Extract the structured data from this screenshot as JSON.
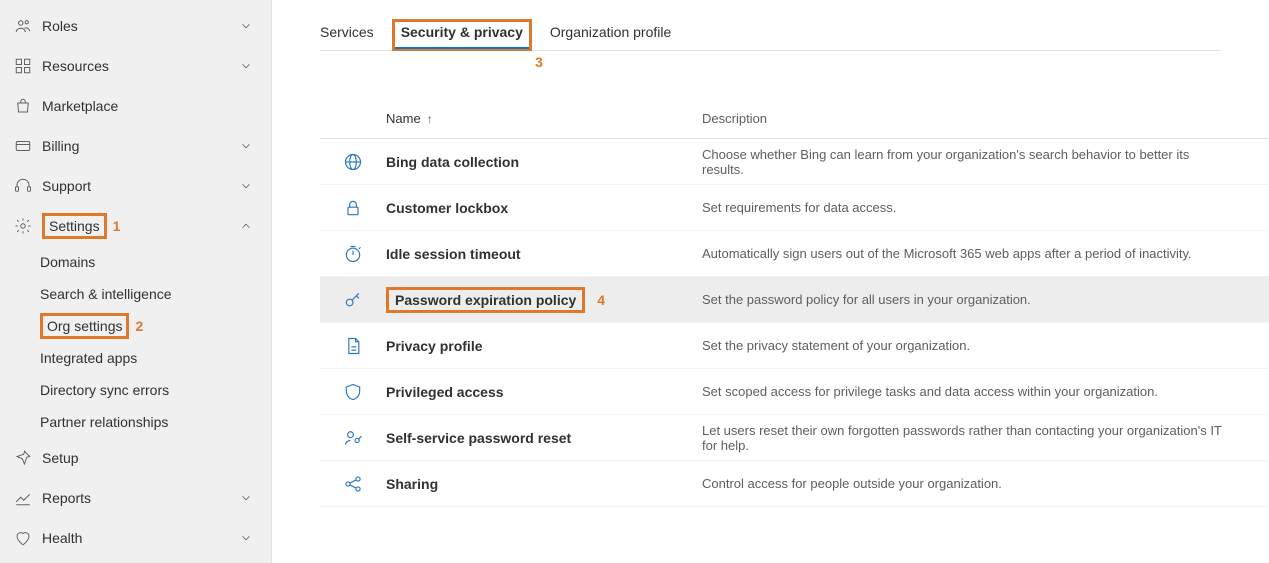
{
  "sidebar": {
    "items": [
      {
        "label": "Roles",
        "icon": "roles-icon",
        "expandable": true,
        "expanded": false
      },
      {
        "label": "Resources",
        "icon": "resources-icon",
        "expandable": true,
        "expanded": false
      },
      {
        "label": "Marketplace",
        "icon": "marketplace-icon",
        "expandable": false
      },
      {
        "label": "Billing",
        "icon": "billing-icon",
        "expandable": true,
        "expanded": false
      },
      {
        "label": "Support",
        "icon": "support-icon",
        "expandable": true,
        "expanded": false
      },
      {
        "label": "Settings",
        "icon": "settings-icon",
        "expandable": true,
        "expanded": true,
        "highlight_num": "1"
      },
      {
        "label": "Setup",
        "icon": "setup-icon",
        "expandable": false
      },
      {
        "label": "Reports",
        "icon": "reports-icon",
        "expandable": true,
        "expanded": false
      },
      {
        "label": "Health",
        "icon": "health-icon",
        "expandable": true,
        "expanded": false
      }
    ],
    "settings_children": [
      {
        "label": "Domains"
      },
      {
        "label": "Search & intelligence"
      },
      {
        "label": "Org settings",
        "highlight_num": "2"
      },
      {
        "label": "Integrated apps"
      },
      {
        "label": "Directory sync errors"
      },
      {
        "label": "Partner relationships"
      }
    ]
  },
  "tabs": [
    {
      "label": "Services",
      "active": false
    },
    {
      "label": "Security & privacy",
      "active": true,
      "highlight_num": "3"
    },
    {
      "label": "Organization profile",
      "active": false
    }
  ],
  "table": {
    "columns": {
      "name": "Name",
      "desc": "Description"
    },
    "rows": [
      {
        "icon": "globe-icon",
        "name": "Bing data collection",
        "desc": "Choose whether Bing can learn from your organization's search behavior to better its results."
      },
      {
        "icon": "lock-icon",
        "name": "Customer lockbox",
        "desc": "Set requirements for data access."
      },
      {
        "icon": "timer-icon",
        "name": "Idle session timeout",
        "desc": "Automatically sign users out of the Microsoft 365 web apps after a period of inactivity."
      },
      {
        "icon": "key-icon",
        "name": "Password expiration policy",
        "desc": "Set the password policy for all users in your organization.",
        "selected": true,
        "highlight_num": "4"
      },
      {
        "icon": "document-icon",
        "name": "Privacy profile",
        "desc": "Set the privacy statement of your organization."
      },
      {
        "icon": "shield-icon",
        "name": "Privileged access",
        "desc": "Set scoped access for privilege tasks and data access within your organization."
      },
      {
        "icon": "person-key-icon",
        "name": "Self-service password reset",
        "desc": "Let users reset their own forgotten passwords rather than contacting your organization's IT for help."
      },
      {
        "icon": "share-icon",
        "name": "Sharing",
        "desc": "Control access for people outside your organization."
      }
    ]
  }
}
